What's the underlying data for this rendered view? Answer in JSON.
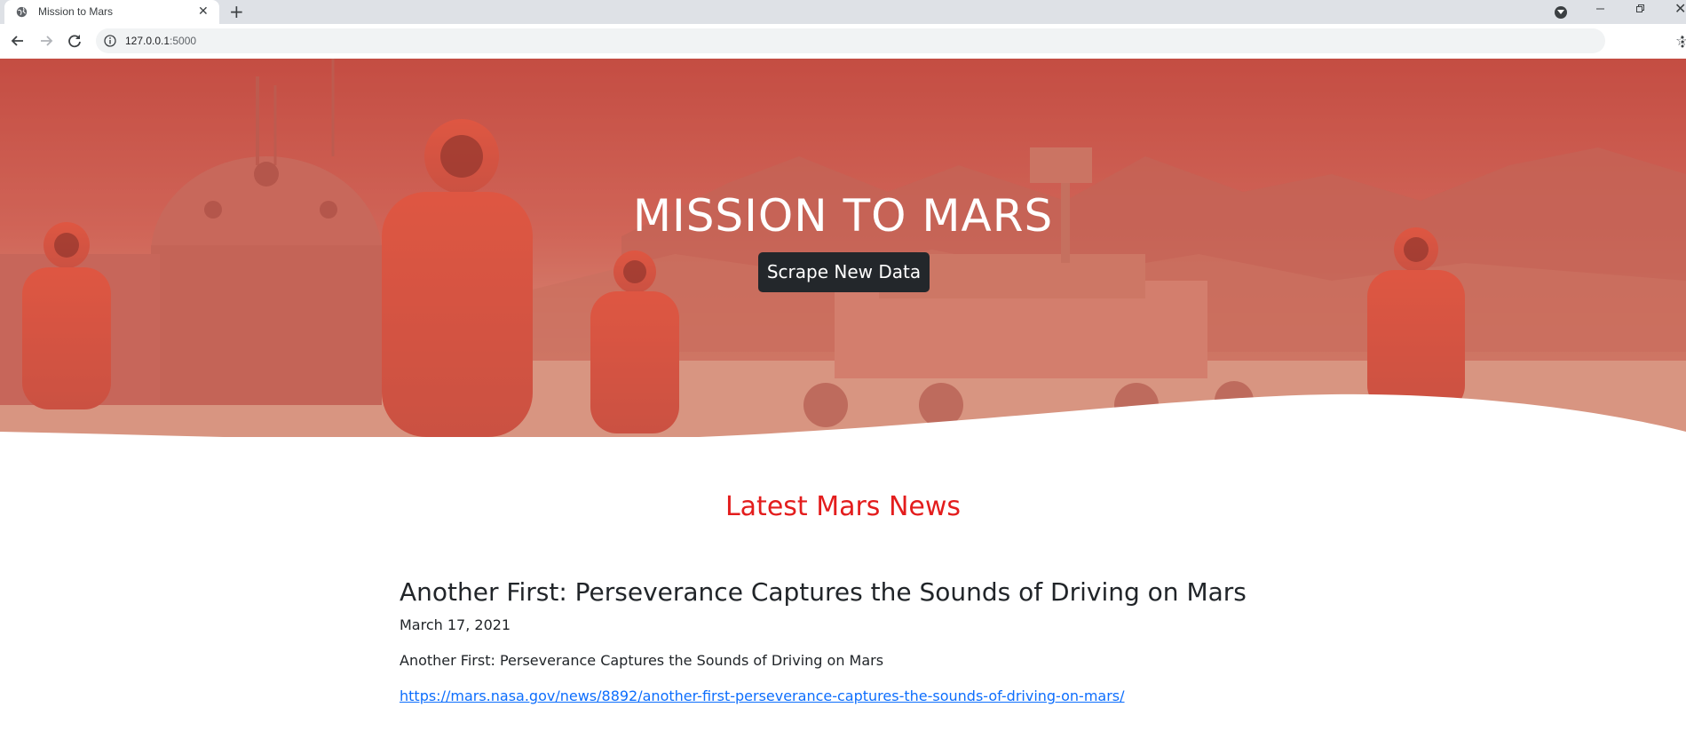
{
  "browser": {
    "tab_title": "Mission to Mars",
    "url_host": "127.0.0.1",
    "url_port": ":5000"
  },
  "hero": {
    "title": "MISSION TO MARS",
    "button_label": "Scrape New Data"
  },
  "news": {
    "heading": "Latest Mars News",
    "title": "Another First: Perseverance Captures the Sounds of Driving on Mars",
    "date": "March 17, 2021",
    "teaser": "Another First: Perseverance Captures the Sounds of Driving on Mars",
    "link": "https://mars.nasa.gov/news/8892/another-first-perseverance-captures-the-sounds-of-driving-on-mars/"
  },
  "colors": {
    "accent_red": "#e31d1d",
    "button_dark": "#23272b",
    "link_blue": "#0d6efd"
  }
}
